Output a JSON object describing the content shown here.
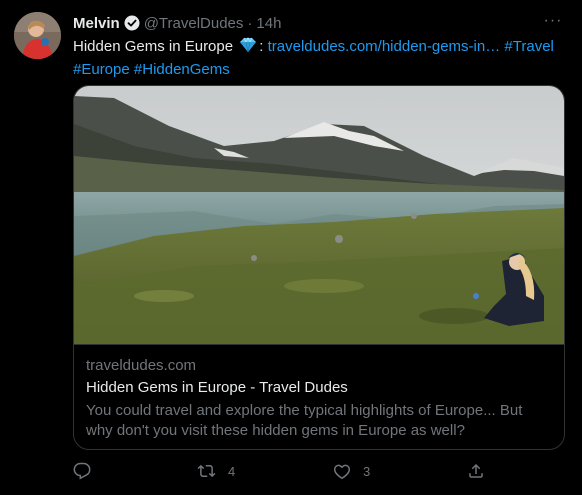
{
  "tweet": {
    "display_name": "Melvin",
    "handle": "@TravelDudes",
    "dot": "·",
    "time": "14h",
    "more": "···",
    "text_intro": "Hidden Gems in Europe",
    "text_colon": ":",
    "link": "traveldudes.com/hidden-gems-in…",
    "hashtags": [
      "#Travel",
      "#Europe",
      "#HiddenGems"
    ]
  },
  "card": {
    "domain": "traveldudes.com",
    "title": "Hidden Gems in Europe - Travel Dudes",
    "description": "You could travel and explore the typical highlights of Europe... But why don't you visit these hidden gems in Europe as well?"
  },
  "actions": {
    "reply_count": "",
    "retweet_count": "4",
    "like_count": "3"
  },
  "icons": {
    "verified": "verified-badge-icon",
    "gem": "gem-emoji-icon",
    "more": "more-options-icon",
    "reply": "reply-icon",
    "retweet": "retweet-icon",
    "like": "heart-icon",
    "share": "share-icon"
  },
  "colors": {
    "background": "#000000",
    "text": "#e7e9ea",
    "secondary": "#71767b",
    "accent": "#1d9bf0",
    "border": "#2f3336"
  }
}
